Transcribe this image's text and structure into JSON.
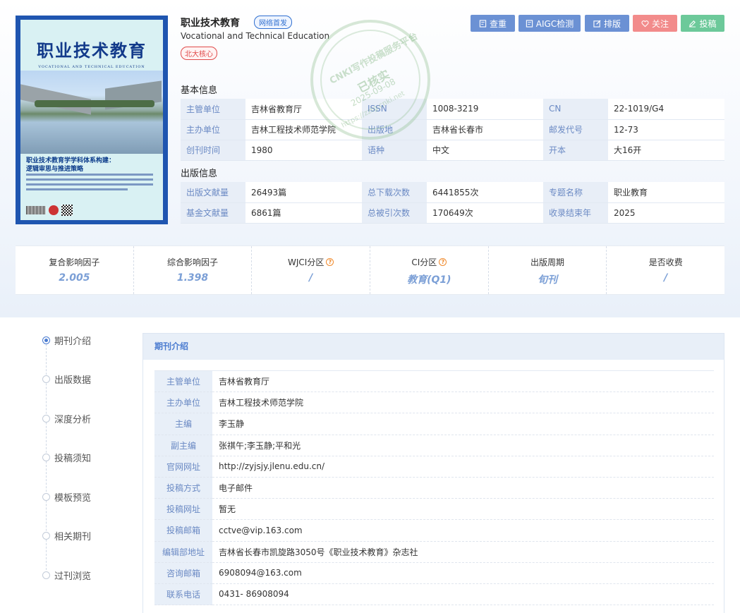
{
  "journal": {
    "title": "职业技术教育",
    "english_title": "Vocational and Technical Education",
    "tag_network": "网络首发",
    "tag_core": "北大核心"
  },
  "cover": {
    "title": "职业技术教育",
    "subtitle": "VOCATIONAL AND TECHNICAL EDUCATION",
    "headline1": "职业技术教育学学科体系构建：",
    "headline2": "逻辑审思与推进策略"
  },
  "buttons": {
    "check": "查重",
    "aigc": "AIGC检测",
    "layout": "排版",
    "follow": "关注",
    "submit": "投稿"
  },
  "basic_info": {
    "title": "基本信息",
    "rows": [
      [
        {
          "k": "主管单位",
          "v": "吉林省教育厅"
        },
        {
          "k": "ISSN",
          "v": "1008-3219"
        },
        {
          "k": "CN",
          "v": "22-1019/G4"
        }
      ],
      [
        {
          "k": "主办单位",
          "v": "吉林工程技术师范学院"
        },
        {
          "k": "出版地",
          "v": "吉林省长春市"
        },
        {
          "k": "邮发代号",
          "v": "12-73"
        }
      ],
      [
        {
          "k": "创刊时间",
          "v": "1980"
        },
        {
          "k": "语种",
          "v": "中文"
        },
        {
          "k": "开本",
          "v": "大16开"
        }
      ]
    ]
  },
  "pub_info": {
    "title": "出版信息",
    "rows": [
      [
        {
          "k": "出版文献量",
          "v": "26493篇"
        },
        {
          "k": "总下载次数",
          "v": "6441855次"
        },
        {
          "k": "专题名称",
          "v": "职业教育"
        }
      ],
      [
        {
          "k": "基金文献量",
          "v": "6861篇"
        },
        {
          "k": "总被引次数",
          "v": "170649次"
        },
        {
          "k": "收录结束年",
          "v": "2025"
        }
      ]
    ]
  },
  "stats": [
    {
      "label": "复合影响因子",
      "value": "2.005",
      "help": false
    },
    {
      "label": "综合影响因子",
      "value": "1.398",
      "help": false
    },
    {
      "label": "WJCI分区",
      "value": "/",
      "help": true
    },
    {
      "label": "CI分区",
      "value": "教育(Q1)",
      "help": true
    },
    {
      "label": "出版周期",
      "value": "旬刊",
      "help": false
    },
    {
      "label": "是否收费",
      "value": "/",
      "help": false
    }
  ],
  "stamp": {
    "line1": "CNKI写作投稿服务平台",
    "line2": "已核实",
    "line3": "2025-09-08",
    "line4": "https://zztg.cnki.net"
  },
  "side_nav": [
    "期刊介绍",
    "出版数据",
    "深度分析",
    "投稿须知",
    "模板预览",
    "相关期刊",
    "过刊浏览"
  ],
  "panel": {
    "title": "期刊介绍",
    "rows": [
      {
        "k": "主管单位",
        "v": "吉林省教育厅"
      },
      {
        "k": "主办单位",
        "v": "吉林工程技术师范学院"
      },
      {
        "k": "主编",
        "v": "李玉静"
      },
      {
        "k": "副主编",
        "v": "张祺午;李玉静;平和光"
      },
      {
        "k": "官网网址",
        "v": "http://zyjsjy.jlenu.edu.cn/"
      },
      {
        "k": "投稿方式",
        "v": "电子邮件"
      },
      {
        "k": "投稿网址",
        "v": "暂无"
      },
      {
        "k": "投稿邮箱",
        "v": "cctve@vip.163.com"
      },
      {
        "k": "编辑部地址",
        "v": "吉林省长春市凯旋路3050号《职业技术教育》杂志社"
      },
      {
        "k": "咨询邮箱",
        "v": "6908094@163.com"
      },
      {
        "k": "联系电话",
        "v": "0431- 86908094"
      }
    ]
  }
}
